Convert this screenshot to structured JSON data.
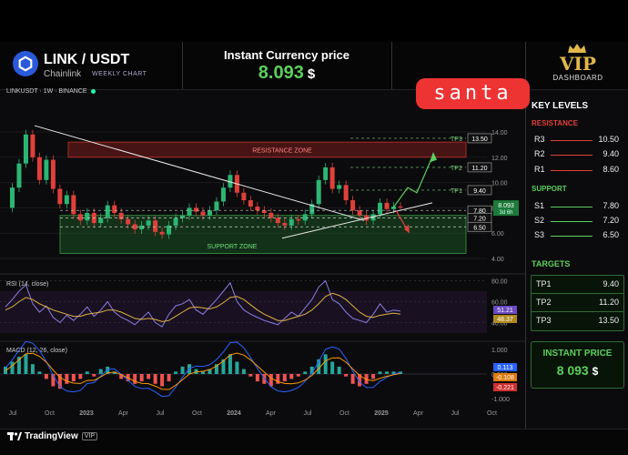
{
  "header": {
    "pair": "LINK / USDT",
    "subtitle": "Chainlink",
    "timeframe_badge": "WEEKLY CHART",
    "instant_label": "Instant  Currency price",
    "instant_value": "8.093",
    "currency": "$",
    "vip_text": "VIP",
    "vip_sub": "DASHBOARD",
    "watermark": "santa"
  },
  "chart_meta": {
    "symbol": "LINKUSDT · 1W · BINANCE",
    "resistance_label": "RESISTANCE ZONE",
    "support_label": "SUPPORT ZONE",
    "current_price_tag": "8.093",
    "countdown_tag": "3d 6h",
    "rsi_label": "RSI (14, close)",
    "macd_label": "MACD (12, 26, close)"
  },
  "chart_data": {
    "type": "line",
    "title": "",
    "price_axis": [
      4.0,
      6.0,
      8.0,
      10.0,
      12.0,
      14.0
    ],
    "x_ticks": [
      "Jul",
      "Oct",
      "2023",
      "Apr",
      "Jul",
      "Oct",
      "2024",
      "Apr",
      "Jul",
      "Oct",
      "2025",
      "Apr",
      "Jul",
      "Oct"
    ],
    "close_series": [
      {
        "t": 0,
        "v": 8.0
      },
      {
        "t": 2,
        "v": 9.6
      },
      {
        "t": 4,
        "v": 11.5
      },
      {
        "t": 6,
        "v": 13.8
      },
      {
        "t": 8,
        "v": 12.0
      },
      {
        "t": 10,
        "v": 10.2
      },
      {
        "t": 12,
        "v": 11.8
      },
      {
        "t": 14,
        "v": 9.5
      },
      {
        "t": 16,
        "v": 8.3
      },
      {
        "t": 18,
        "v": 9.0
      },
      {
        "t": 20,
        "v": 7.5
      },
      {
        "t": 22,
        "v": 7.0
      },
      {
        "t": 24,
        "v": 7.6
      },
      {
        "t": 26,
        "v": 6.8
      },
      {
        "t": 28,
        "v": 7.2
      },
      {
        "t": 30,
        "v": 8.2
      },
      {
        "t": 32,
        "v": 7.6
      },
      {
        "t": 34,
        "v": 7.1
      },
      {
        "t": 36,
        "v": 6.7
      },
      {
        "t": 38,
        "v": 6.3
      },
      {
        "t": 40,
        "v": 6.6
      },
      {
        "t": 42,
        "v": 7.0
      },
      {
        "t": 44,
        "v": 6.1
      },
      {
        "t": 46,
        "v": 5.9
      },
      {
        "t": 48,
        "v": 6.6
      },
      {
        "t": 50,
        "v": 7.2
      },
      {
        "t": 52,
        "v": 7.4
      },
      {
        "t": 54,
        "v": 8.0
      },
      {
        "t": 56,
        "v": 7.7
      },
      {
        "t": 58,
        "v": 7.4
      },
      {
        "t": 60,
        "v": 7.8
      },
      {
        "t": 62,
        "v": 8.5
      },
      {
        "t": 64,
        "v": 9.6
      },
      {
        "t": 66,
        "v": 10.6
      },
      {
        "t": 68,
        "v": 9.2
      },
      {
        "t": 70,
        "v": 8.6
      },
      {
        "t": 72,
        "v": 8.1
      },
      {
        "t": 74,
        "v": 7.8
      },
      {
        "t": 76,
        "v": 7.6
      },
      {
        "t": 78,
        "v": 7.2
      },
      {
        "t": 80,
        "v": 6.8
      },
      {
        "t": 82,
        "v": 6.6
      },
      {
        "t": 84,
        "v": 7.1
      },
      {
        "t": 86,
        "v": 7.0
      },
      {
        "t": 88,
        "v": 7.5
      },
      {
        "t": 90,
        "v": 8.3
      },
      {
        "t": 92,
        "v": 10.2
      },
      {
        "t": 94,
        "v": 11.2
      },
      {
        "t": 96,
        "v": 9.5
      },
      {
        "t": 98,
        "v": 9.8
      },
      {
        "t": 100,
        "v": 8.6
      },
      {
        "t": 102,
        "v": 7.8
      },
      {
        "t": 104,
        "v": 7.4
      },
      {
        "t": 106,
        "v": 7.0
      },
      {
        "t": 108,
        "v": 7.5
      },
      {
        "t": 110,
        "v": 8.4
      },
      {
        "t": 112,
        "v": 7.9
      },
      {
        "t": 114,
        "v": 8.1
      },
      {
        "t": 116,
        "v": 8.093
      }
    ],
    "resistance_zone": [
      12.0,
      13.2
    ],
    "support_zone": [
      4.4,
      7.4
    ],
    "levels": [
      {
        "label": "TP3",
        "value": 13.5,
        "tag": "13.50"
      },
      {
        "label": "TP2",
        "value": 11.2,
        "tag": "11.20"
      },
      {
        "label": "TP1",
        "value": 9.4,
        "tag": "9.40"
      },
      {
        "label": "",
        "value": 7.8,
        "tag": "7.80"
      },
      {
        "label": "",
        "value": 7.2,
        "tag": "7.20"
      },
      {
        "label": "",
        "value": 6.5,
        "tag": "6.50"
      }
    ],
    "rsi": {
      "axis": [
        40.0,
        60.0,
        80.0
      ],
      "value_tags": [
        "51.21",
        "48.37"
      ],
      "values": [
        55,
        62,
        70,
        76,
        58,
        50,
        56,
        45,
        40,
        47,
        42,
        48,
        55,
        46,
        52,
        60,
        50,
        45,
        42,
        38,
        44,
        50,
        40,
        36,
        48,
        56,
        58,
        62,
        52,
        48,
        55,
        62,
        70,
        78,
        60,
        52,
        48,
        45,
        42,
        40,
        38,
        44,
        50,
        46,
        54,
        62,
        74,
        80,
        62,
        58,
        50,
        44,
        42,
        40,
        48,
        58,
        50,
        52,
        51
      ],
      "ma": [
        52,
        55,
        60,
        64,
        62,
        58,
        55,
        52,
        50,
        48,
        46,
        46,
        48,
        49,
        50,
        52,
        52,
        50,
        47,
        44,
        43,
        44,
        43,
        41,
        42,
        46,
        50,
        54,
        55,
        54,
        53,
        55,
        59,
        64,
        65,
        62,
        57,
        52,
        48,
        45,
        42,
        42,
        44,
        46,
        48,
        52,
        58,
        65,
        68,
        66,
        62,
        56,
        50,
        46,
        45,
        47,
        48,
        49,
        48
      ]
    },
    "macd": {
      "axis": [
        1.0,
        0.0,
        -1.0
      ],
      "value_tags": [
        "0.113",
        "-0.108",
        "-0.221"
      ],
      "hist": [
        0.3,
        0.5,
        0.7,
        0.8,
        0.4,
        0.1,
        -0.2,
        -0.5,
        -0.6,
        -0.4,
        -0.3,
        -0.2,
        0.1,
        -0.1,
        0.2,
        0.3,
        0.1,
        -0.2,
        -0.3,
        -0.4,
        -0.3,
        -0.2,
        -0.4,
        -0.5,
        -0.3,
        0.1,
        0.3,
        0.4,
        0.2,
        0.1,
        0.2,
        0.4,
        0.6,
        0.8,
        0.5,
        0.2,
        -0.1,
        -0.3,
        -0.4,
        -0.5,
        -0.4,
        -0.3,
        -0.2,
        -0.1,
        0.1,
        0.3,
        0.6,
        0.8,
        0.5,
        0.3,
        -0.1,
        -0.4,
        -0.5,
        -0.4,
        -0.2,
        0.1,
        0.1,
        0.1,
        0.1
      ]
    }
  },
  "sidebar": {
    "key_levels_title": "KEY LEVELS",
    "resistance_title": "RESISTANCE",
    "support_title": "SUPPORT",
    "resistance": [
      {
        "label": "R3",
        "value": "10.50"
      },
      {
        "label": "R2",
        "value": "9.40"
      },
      {
        "label": "R1",
        "value": "8.60"
      }
    ],
    "support": [
      {
        "label": "S1",
        "value": "7.80"
      },
      {
        "label": "S2",
        "value": "7.20"
      },
      {
        "label": "S3",
        "value": "6.50"
      }
    ],
    "targets_title": "TARGETS",
    "targets": [
      {
        "label": "TP1",
        "value": "9.40"
      },
      {
        "label": "TP2",
        "value": "11.20"
      },
      {
        "label": "TP3",
        "value": "13.50"
      }
    ],
    "instant_price_title": "INSTANT PRICE",
    "instant_price_value": "8 093",
    "instant_price_currency": "$"
  },
  "footer": {
    "brand": "TradingView",
    "badge": "VIP"
  },
  "colors": {
    "accent_green": "#5bd05b",
    "resistance_red": "#e0403a",
    "link_blue": "#2a5ada",
    "vip_gold": "#e2b84a"
  }
}
